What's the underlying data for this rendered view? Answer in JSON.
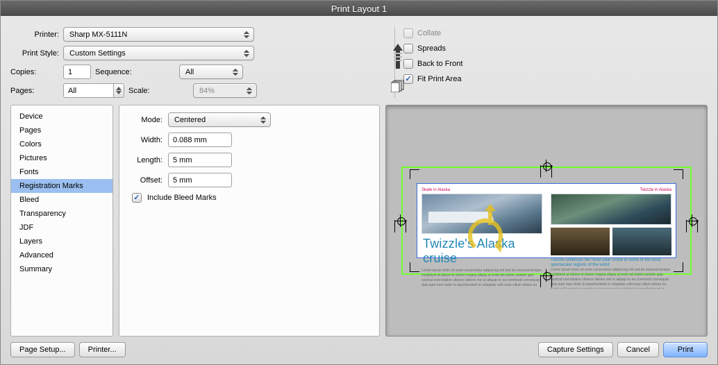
{
  "window": {
    "title": "Print Layout 1"
  },
  "printer": {
    "label": "Printer:",
    "value": "Sharp MX-5111N"
  },
  "print_style": {
    "label": "Print Style:",
    "value": "Custom Settings"
  },
  "copies": {
    "label": "Copies:",
    "value": "1"
  },
  "sequence": {
    "label": "Sequence:",
    "value": "All"
  },
  "pages": {
    "label": "Pages:",
    "value": "All"
  },
  "scale": {
    "label": "Scale:",
    "value": "84%"
  },
  "options": {
    "collate": {
      "label": "Collate",
      "checked": false,
      "enabled": false
    },
    "spreads": {
      "label": "Spreads",
      "checked": false,
      "enabled": true
    },
    "back_to_front": {
      "label": "Back to Front",
      "checked": false,
      "enabled": true
    },
    "fit_print_area": {
      "label": "Fit Print Area",
      "checked": true,
      "enabled": true
    }
  },
  "help_label": "?",
  "sidebar": {
    "items": [
      "Device",
      "Pages",
      "Colors",
      "Pictures",
      "Fonts",
      "Registration Marks",
      "Bleed",
      "Transparency",
      "JDF",
      "Layers",
      "Advanced",
      "Summary"
    ],
    "selected_index": 5
  },
  "detail": {
    "mode": {
      "label": "Mode:",
      "value": "Centered"
    },
    "width": {
      "label": "Width:",
      "value": "0.088 mm"
    },
    "length": {
      "label": "Length:",
      "value": "5 mm"
    },
    "offset": {
      "label": "Offset:",
      "value": "5 mm"
    },
    "include_bleed": {
      "label": "Include Bleed Marks",
      "checked": true
    }
  },
  "preview": {
    "headline": "Twizzle's Alaska cruise",
    "caption_left": "Skate in Alaska",
    "caption_right": "Twizzle in Alaska",
    "subhead": "Twizzle continues her three-year cruise to some of the most spectacular regions of the world"
  },
  "buttons": {
    "page_setup": "Page Setup...",
    "printer": "Printer...",
    "capture": "Capture Settings",
    "cancel": "Cancel",
    "print": "Print"
  }
}
